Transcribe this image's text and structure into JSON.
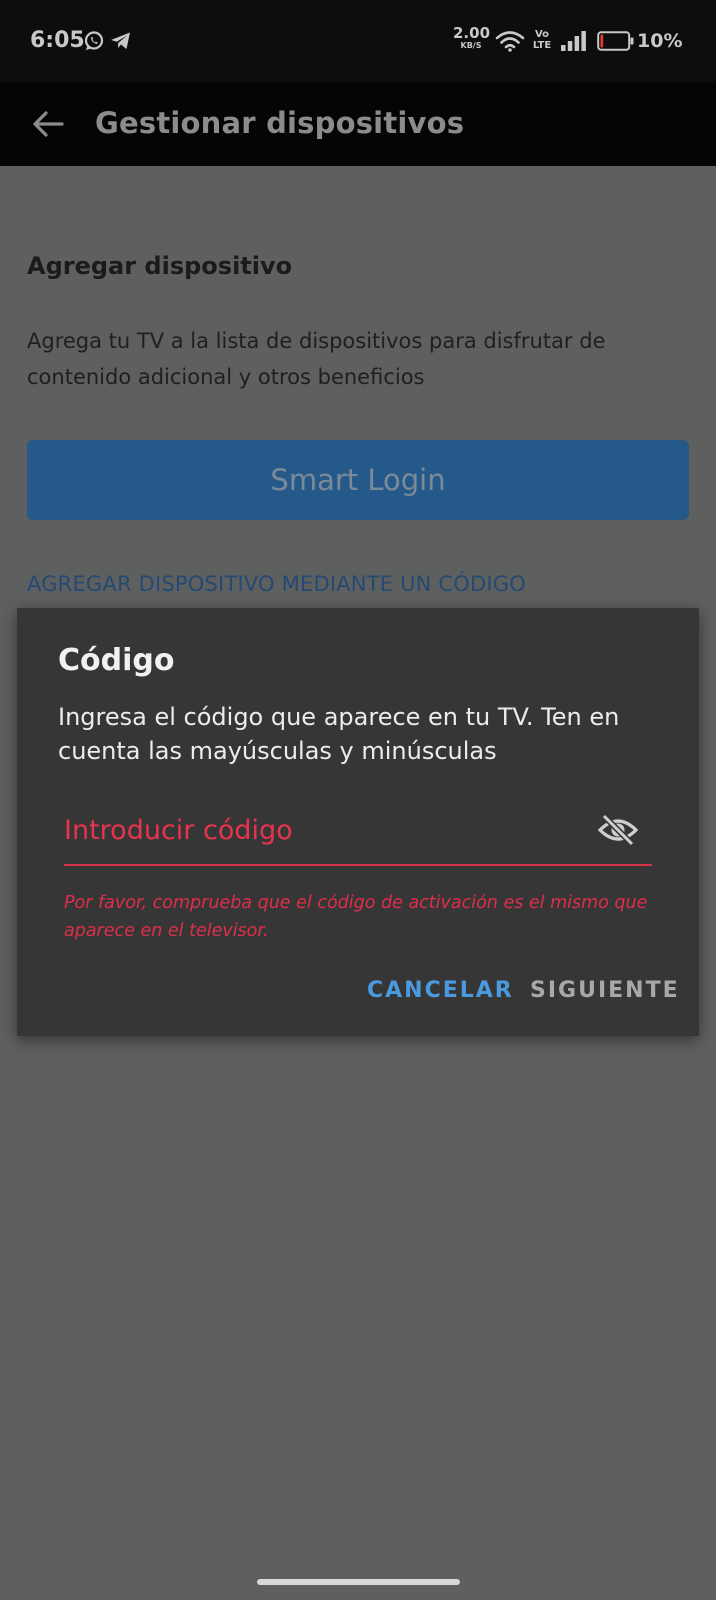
{
  "status_bar": {
    "time": "6:05",
    "network_speed_value": "2.00",
    "network_speed_unit": "KB/S",
    "volte_top": "Vo",
    "volte_bottom": "LTE",
    "battery_percent": "10%",
    "icons": [
      "whatsapp-icon",
      "telegram-icon",
      "wifi-icon",
      "signal-icon",
      "battery-icon"
    ],
    "battery_level": 0.1,
    "battery_color": "#e53935"
  },
  "app_bar": {
    "title": "Gestionar dispositivos",
    "back_icon": "arrow-back-icon"
  },
  "page": {
    "section_title": "Agregar dispositivo",
    "section_description": "Agrega tu TV a la lista de dispositivos para disfrutar de contenido adicional y otros beneficios",
    "smart_login_label": "Smart Login",
    "add_by_code_label": "AGREGAR DISPOSITIVO MEDIANTE UN CÓDIGO"
  },
  "dialog": {
    "title": "Código",
    "message": "Ingresa el código que aparece en tu TV. Ten en cuenta las mayúsculas y minúsculas",
    "input_value": "",
    "input_placeholder": "Introducir código",
    "visibility_icon": "visibility-off-icon",
    "error_message": "Por favor, comprueba que el código de activación es el mismo que aparece en el televisor.",
    "cancel_label": "CANCELAR",
    "next_label": "SIGUIENTE"
  },
  "colors": {
    "accent_blue": "#4a9ae0",
    "error_red": "#e8334f",
    "smart_login_button": "#24598a",
    "dialog_background": "#363636",
    "scrim_background": "#5e5f5f"
  }
}
